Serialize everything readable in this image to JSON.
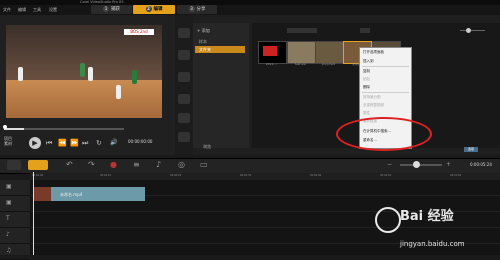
{
  "window": {
    "title": "Corel VideoStudio Pro X5"
  },
  "menu": {
    "items": [
      "文件",
      "编辑",
      "工具",
      "设置"
    ]
  },
  "steps": [
    {
      "num": "1",
      "label": "捕获"
    },
    {
      "num": "2",
      "label": "编辑"
    },
    {
      "num": "3",
      "label": "分享"
    }
  ],
  "player": {
    "scoreboard": "BOS 2nd",
    "project_label": "项目\n素材",
    "timecode": "00:00:00:00",
    "controls": [
      "⏮",
      "⏪",
      "⏩",
      "⏭",
      "↻",
      "🔊"
    ]
  },
  "library": {
    "add_label": "+ 添加",
    "folders": [
      "样本",
      "文件夹"
    ],
    "browse_label": "浏览",
    "options_label": "选项",
    "thumbnails": [
      {
        "label": "2011-..."
      },
      {
        "label": "test.avi"
      },
      {
        "label": "proj.mp4"
      },
      {
        "label": "未命名"
      },
      {
        "label": "clip5"
      }
    ]
  },
  "context_menu": {
    "items": [
      {
        "label": "打开选项面板",
        "disabled": false
      },
      {
        "label": "插入到",
        "disabled": false
      },
      {
        "label": "复制",
        "disabled": false
      },
      {
        "label": "粘贴",
        "disabled": true
      },
      {
        "label": "删除",
        "disabled": false
      },
      {
        "label": "按场景分割",
        "disabled": true
      },
      {
        "label": "多重修整视频",
        "disabled": true
      },
      {
        "label": "属性",
        "disabled": true
      },
      {
        "label": "重新链接",
        "disabled": true
      },
      {
        "label": "在计算机中搜索...",
        "disabled": false
      },
      {
        "label": "重命名...",
        "disabled": false
      }
    ]
  },
  "timeline": {
    "timecode": "0:00:05:24",
    "ruler_ticks": [
      "00:00:00",
      "00:00:10",
      "00:00:20",
      "00:00:30",
      "00:00:40",
      "00:00:50",
      "00:01:00"
    ],
    "clip_label": "未命名.mp4"
  },
  "watermark": {
    "brand": "Bai 经验",
    "url": "jingyan.baidu.com"
  },
  "colors": {
    "accent": "#e4a11b",
    "clip": "#6d9aa8",
    "highlight": "#dd2222"
  }
}
